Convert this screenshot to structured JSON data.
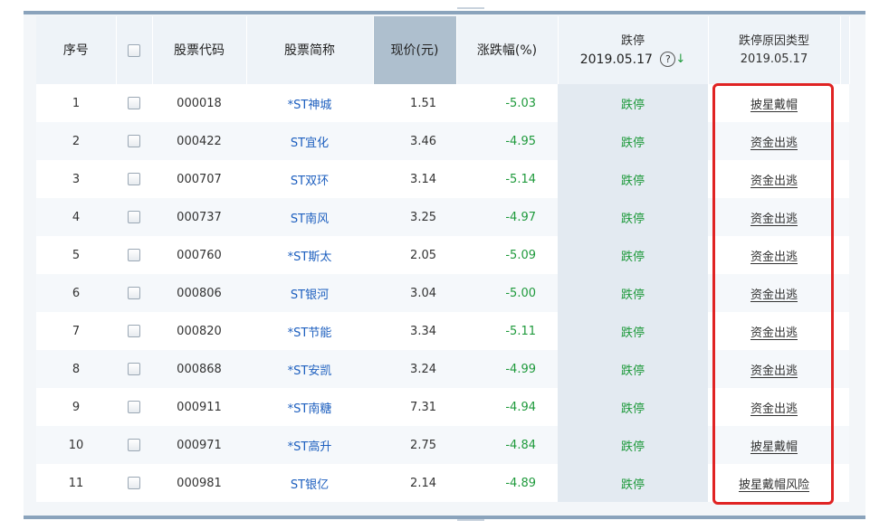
{
  "headers": {
    "seq": "序号",
    "code": "股票代码",
    "name": "股票简称",
    "price": "现价(元)",
    "change": "涨跌幅(%)",
    "drop_title": "跌停",
    "drop_date": "2019.05.17",
    "reason_title": "跌停原因类型",
    "reason_date": "2019.05.17",
    "help_glyph": "?",
    "sort_glyph": "↓"
  },
  "icons": {
    "help": "question-circle-icon",
    "sort": "arrow-down-icon",
    "checkbox": "checkbox-icon"
  },
  "colors": {
    "link_blue": "#1d5fbf",
    "drop_green": "#1f9a3c",
    "highlight_red": "#e02323",
    "header_sorted": "#aebfce"
  },
  "rows": [
    {
      "seq": "1",
      "code": "000018",
      "name": "*ST神城",
      "price": "1.51",
      "change": "-5.03",
      "drop": "跌停",
      "reason": "披星戴帽"
    },
    {
      "seq": "2",
      "code": "000422",
      "name": "ST宜化",
      "price": "3.46",
      "change": "-4.95",
      "drop": "跌停",
      "reason": "资金出逃"
    },
    {
      "seq": "3",
      "code": "000707",
      "name": "ST双环",
      "price": "3.14",
      "change": "-5.14",
      "drop": "跌停",
      "reason": "资金出逃"
    },
    {
      "seq": "4",
      "code": "000737",
      "name": "ST南风",
      "price": "3.25",
      "change": "-4.97",
      "drop": "跌停",
      "reason": "资金出逃"
    },
    {
      "seq": "5",
      "code": "000760",
      "name": "*ST斯太",
      "price": "2.05",
      "change": "-5.09",
      "drop": "跌停",
      "reason": "资金出逃"
    },
    {
      "seq": "6",
      "code": "000806",
      "name": "ST银河",
      "price": "3.04",
      "change": "-5.00",
      "drop": "跌停",
      "reason": "资金出逃"
    },
    {
      "seq": "7",
      "code": "000820",
      "name": "*ST节能",
      "price": "3.34",
      "change": "-5.11",
      "drop": "跌停",
      "reason": "资金出逃"
    },
    {
      "seq": "8",
      "code": "000868",
      "name": "*ST安凯",
      "price": "3.24",
      "change": "-4.99",
      "drop": "跌停",
      "reason": "资金出逃"
    },
    {
      "seq": "9",
      "code": "000911",
      "name": "*ST南糖",
      "price": "7.31",
      "change": "-4.94",
      "drop": "跌停",
      "reason": "资金出逃"
    },
    {
      "seq": "10",
      "code": "000971",
      "name": "*ST高升",
      "price": "2.75",
      "change": "-4.84",
      "drop": "跌停",
      "reason": "披星戴帽"
    },
    {
      "seq": "11",
      "code": "000981",
      "name": "ST银亿",
      "price": "2.14",
      "change": "-4.89",
      "drop": "跌停",
      "reason": "披星戴帽风险"
    }
  ]
}
